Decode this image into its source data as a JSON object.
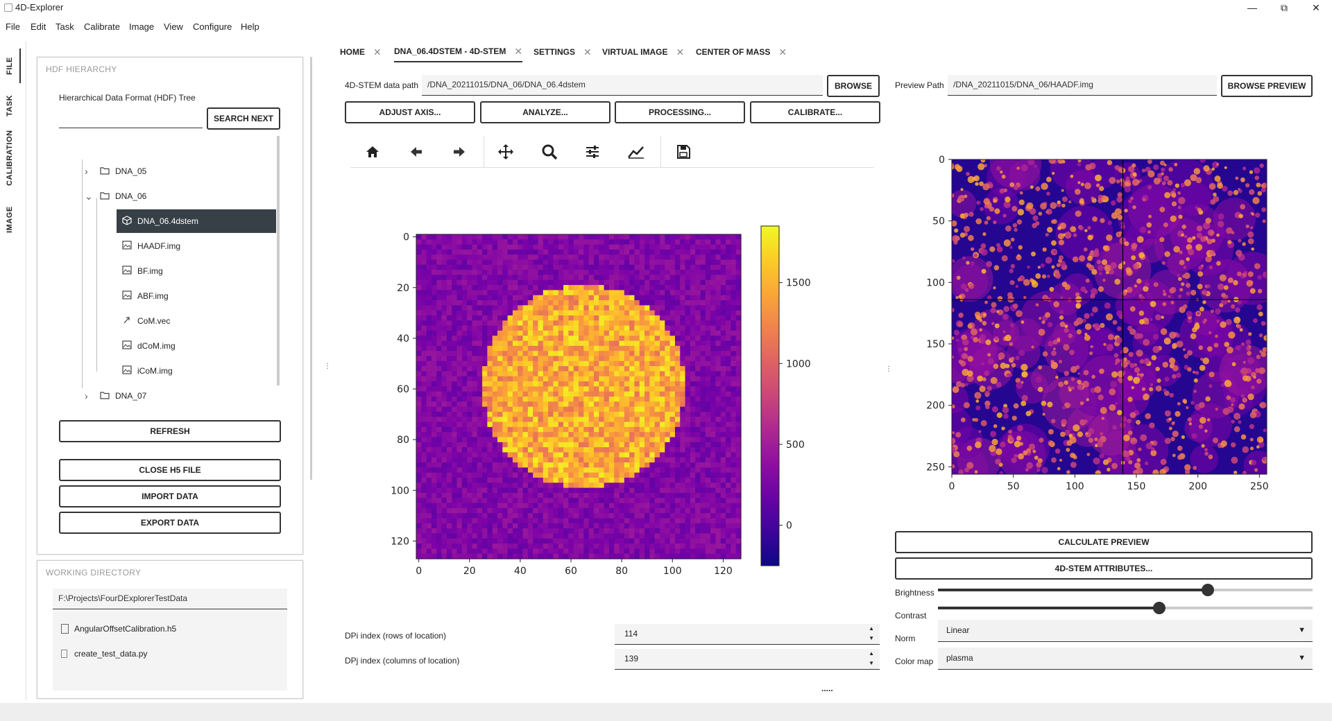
{
  "window": {
    "title": "4D-Explorer",
    "minimize": "—",
    "maximize": "⧉",
    "close": "✕"
  },
  "menu": [
    "File",
    "Edit",
    "Task",
    "Calibrate",
    "Image",
    "View",
    "Configure",
    "Help"
  ],
  "side_tabs": [
    "FILE",
    "TASK",
    "CALIBRATION",
    "IMAGE"
  ],
  "hdf": {
    "title": "HDF HIERARCHY",
    "tree_label": "Hierarchical Data Format (HDF) Tree",
    "search_value": "",
    "search_next": "SEARCH NEXT",
    "items": [
      {
        "label": "DNA_05",
        "icon": "folder-icon",
        "expander": "›"
      },
      {
        "label": "DNA_06",
        "icon": "folder-icon",
        "expander": "⌄"
      },
      {
        "label": "DNA_06.4dstem",
        "icon": "cube-icon",
        "selected": true
      },
      {
        "label": "HAADF.img",
        "icon": "image-icon"
      },
      {
        "label": "BF.img",
        "icon": "image-icon"
      },
      {
        "label": "ABF.img",
        "icon": "image-icon"
      },
      {
        "label": "CoM.vec",
        "icon": "vector-icon"
      },
      {
        "label": "dCoM.img",
        "icon": "image-icon"
      },
      {
        "label": "iCoM.img",
        "icon": "image-icon"
      },
      {
        "label": "DNA_07",
        "icon": "folder-icon",
        "expander": "›"
      }
    ],
    "refresh": "REFRESH",
    "close_h5": "CLOSE H5 FILE",
    "import": "IMPORT DATA",
    "export": "EXPORT DATA"
  },
  "workdir": {
    "title": "WORKING DIRECTORY",
    "path": "F:\\Projects\\FourDExplorerTestData",
    "files": [
      "AngularOffsetCalibration.h5",
      "create_test_data.py"
    ]
  },
  "tabs": [
    {
      "label": "HOME"
    },
    {
      "label": "DNA_06.4DSTEM - 4D-STEM",
      "active": true
    },
    {
      "label": "SETTINGS"
    },
    {
      "label": "VIRTUAL IMAGE"
    },
    {
      "label": "CENTER OF MASS"
    }
  ],
  "tab_close": "✕",
  "stem": {
    "path_label": "4D-STEM data path",
    "path": "/DNA_20211015/DNA_06/DNA_06.4dstem",
    "browse": "BROWSE",
    "buttons": [
      "ADJUST AXIS...",
      "ANALYZE...",
      "PROCESSING...",
      "CALIBRATE..."
    ],
    "tools": [
      "home-icon",
      "back-icon",
      "forward-icon",
      "pan-icon",
      "zoom-icon",
      "configure-icon",
      "line-chart-icon",
      "save-icon"
    ],
    "dpi_label": "DPi index (rows of location)",
    "dpi_value": "114",
    "dpj_label": "DPj index (columns of location)",
    "dpj_value": "139",
    "handle": "....."
  },
  "preview": {
    "path_label": "Preview Path",
    "path": "/DNA_20211015/DNA_06/HAADF.img",
    "browse": "BROWSE PREVIEW",
    "calc": "CALCULATE PREVIEW",
    "attrs": "4D-STEM ATTRIBUTES...",
    "brightness_label": "Brightness",
    "brightness": 0.72,
    "contrast_label": "Contrast",
    "contrast": 0.59,
    "norm_label": "Norm",
    "norm": "Linear",
    "cmap_label": "Color map",
    "cmap": "plasma",
    "caret": "▼"
  },
  "chart_data": [
    {
      "type": "heatmap",
      "title": "",
      "xlabel": "",
      "ylabel": "",
      "xlim": [
        0,
        128
      ],
      "ylim": [
        128,
        0
      ],
      "xticks": [
        "0",
        "20",
        "40",
        "60",
        "80",
        "100",
        "120"
      ],
      "yticks": [
        "0",
        "20",
        "40",
        "60",
        "80",
        "100",
        "120"
      ],
      "colormap": "plasma",
      "colorbar": {
        "range": [
          -250,
          1850
        ],
        "ticks": [
          "0",
          "500",
          "1000",
          "1500"
        ]
      },
      "disk": {
        "center_x": 66,
        "center_y": 60,
        "radius": 40,
        "inside_value": 1450,
        "background_value": 300
      }
    },
    {
      "type": "heatmap",
      "title": "",
      "xlabel": "",
      "ylabel": "",
      "xlim": [
        0,
        256
      ],
      "ylim": [
        256,
        0
      ],
      "xticks": [
        "0",
        "50",
        "100",
        "150",
        "200",
        "250"
      ],
      "yticks": [
        "0",
        "50",
        "100",
        "150",
        "200",
        "250"
      ],
      "colormap": "plasma",
      "crosshair": {
        "x": 139,
        "y": 114
      }
    }
  ]
}
